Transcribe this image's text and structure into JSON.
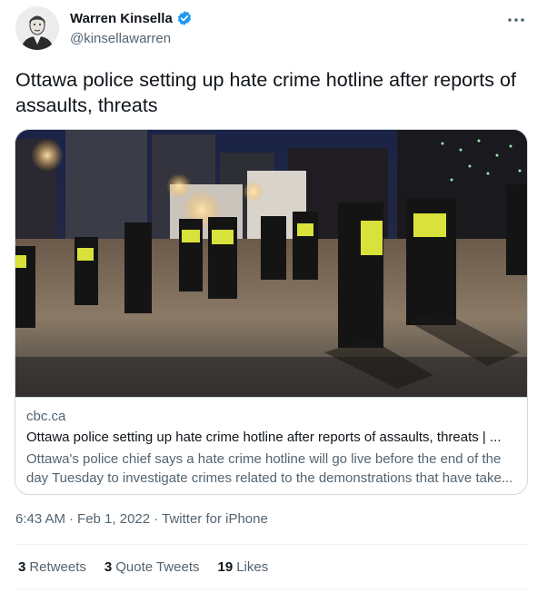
{
  "author": {
    "display_name": "Warren Kinsella",
    "handle": "@kinsellawarren",
    "verified": true,
    "avatar_icon": "portrait-sketch-avatar"
  },
  "tweet": {
    "text": "Ottawa police setting up hate crime hotline after reports of assaults, threats"
  },
  "card": {
    "image_icon": "police-officers-night-photo",
    "domain": "cbc.ca",
    "title": "Ottawa police setting up hate crime hotline after reports of assaults, threats | ...",
    "description": "Ottawa's police chief says a hate crime hotline will go live before the end of the day Tuesday to investigate crimes related to the demonstrations that have take..."
  },
  "timestamp": {
    "time": "6:43 AM",
    "dot1": "·",
    "date": "Feb 1, 2022",
    "dot2": "·",
    "source": "Twitter for iPhone"
  },
  "stats": {
    "retweets_count": "3",
    "retweets_label": "Retweets",
    "quotes_count": "3",
    "quotes_label": "Quote Tweets",
    "likes_count": "19",
    "likes_label": "Likes"
  },
  "colors": {
    "verified_blue": "#1d9bf0",
    "secondary_text": "#536471",
    "border": "#cfd9de"
  }
}
